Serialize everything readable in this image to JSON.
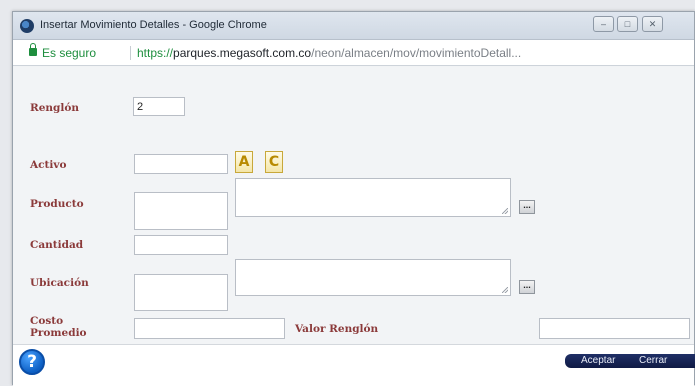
{
  "window": {
    "title": "Insertar Movimiento Detalles - Google Chrome",
    "controls": {
      "minimize": "–",
      "maximize": "□",
      "close": "✕"
    }
  },
  "address_bar": {
    "secure_label": "Es seguro",
    "url_scheme": "https://",
    "url_host": "parques.megasoft.com.co",
    "url_path": "/neon/almacen/mov/movimientoDetall..."
  },
  "form": {
    "renglon": {
      "label": "Renglón",
      "value": "2"
    },
    "activo": {
      "label": "Activo",
      "value": "",
      "btn_a": "A",
      "btn_c": "C"
    },
    "producto": {
      "label": "Producto",
      "code": "",
      "description": "",
      "lookup": "..."
    },
    "cantidad": {
      "label": "Cantidad",
      "value": ""
    },
    "ubicacion": {
      "label": "Ubicación",
      "code": "",
      "description": "",
      "lookup": "..."
    },
    "costo_promedio": {
      "label_line1": "Costo",
      "label_line2": "Promedio",
      "value": ""
    },
    "valor_renglon": {
      "label": "Valor Renglón",
      "value": ""
    }
  },
  "footer": {
    "help": "?",
    "accept_label": "Aceptar",
    "close_label": "Cerrar"
  },
  "colors": {
    "label": "#8b3a3a",
    "secure": "#1e8e3e",
    "action_bar": "#1f2f66",
    "help": "#0d5fc4"
  }
}
